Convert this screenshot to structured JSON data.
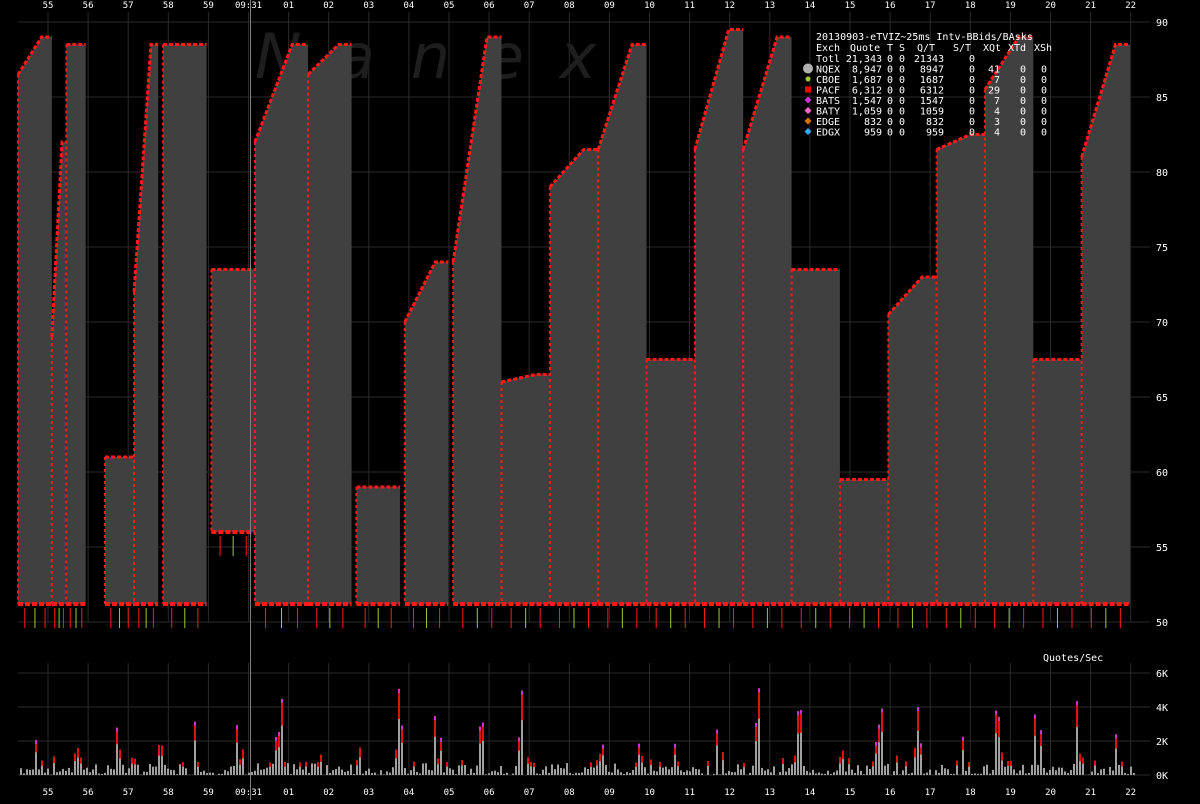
{
  "colors": {
    "background": "#000000",
    "bar_fill": "#404040",
    "grid": "#2a2a2a",
    "bid_ask": "#ff1a1a",
    "text": "#ffffff",
    "watermark": "#1e1e1e",
    "crosshair": "#808080"
  },
  "watermark_text": "N a n e x",
  "legend": {
    "title": "20130903-eTVIZ~25ms Intv-BBids/BAsks",
    "header": [
      "Exch",
      "Quote",
      "T",
      "S",
      "Q/T",
      "S/T",
      "XQt",
      "XTd",
      "XSh"
    ],
    "rows": [
      {
        "exch": "Totl",
        "quote": "21,343",
        "t": "0",
        "s": "0",
        "qt": "21343",
        "st": "0",
        "xqt": "",
        "xtd": "",
        "xsh": "",
        "color": "",
        "marker": ""
      },
      {
        "exch": "NQEX",
        "quote": "8,947",
        "t": "0",
        "s": "0",
        "qt": "8947",
        "st": "0",
        "xqt": "41",
        "xtd": "0",
        "xsh": "0",
        "color": "#b0b0b0",
        "marker": "circle"
      },
      {
        "exch": "CBOE",
        "quote": "1,687",
        "t": "0",
        "s": "0",
        "qt": "1687",
        "st": "0",
        "xqt": "7",
        "xtd": "0",
        "xsh": "0",
        "color": "#9acd32",
        "marker": "dot"
      },
      {
        "exch": "PACF",
        "quote": "6,312",
        "t": "0",
        "s": "0",
        "qt": "6312",
        "st": "0",
        "xqt": "29",
        "xtd": "0",
        "xsh": "0",
        "color": "#ff0000",
        "marker": "square"
      },
      {
        "exch": "BATS",
        "quote": "1,547",
        "t": "0",
        "s": "0",
        "qt": "1547",
        "st": "0",
        "xqt": "7",
        "xtd": "0",
        "xsh": "0",
        "color": "#cc33cc",
        "marker": "diamond"
      },
      {
        "exch": "BATY",
        "quote": "1,059",
        "t": "0",
        "s": "0",
        "qt": "1059",
        "st": "0",
        "xqt": "4",
        "xtd": "0",
        "xsh": "0",
        "color": "#ff66cc",
        "marker": "diamond"
      },
      {
        "exch": "EDGE",
        "quote": "832",
        "t": "0",
        "s": "0",
        "qt": "832",
        "st": "0",
        "xqt": "3",
        "xtd": "0",
        "xsh": "0",
        "color": "#e07000",
        "marker": "diamond"
      },
      {
        "exch": "EDGX",
        "quote": "959",
        "t": "0",
        "s": "0",
        "qt": "959",
        "st": "0",
        "xqt": "4",
        "xtd": "0",
        "xsh": "0",
        "color": "#33aaff",
        "marker": "diamond"
      }
    ]
  },
  "volume_panel_label": "Quotes/Sec",
  "chart_data": [
    {
      "type": "bar",
      "name": "",
      "x_tick_labels": [
        "55",
        "56",
        "57",
        "58",
        "59",
        "09:31",
        "01",
        "02",
        "03",
        "04",
        "05",
        "06",
        "07",
        "08",
        "09",
        "10",
        "11",
        "12",
        "13",
        "14",
        "15",
        "16",
        "17",
        "18",
        "19",
        "20",
        "21",
        "22"
      ],
      "y_tick_labels": [
        "50",
        "55",
        "60",
        "65",
        "70",
        "75",
        "80",
        "85",
        "90"
      ],
      "ylim": [
        50,
        90
      ],
      "grid": true,
      "y_axis_side": "right",
      "x_axis_side": "top-and-bottom",
      "cursor_label": "09:31",
      "description_of_pattern": "",
      "best_bid_floor": 51.2,
      "segments": [
        {
          "x": [
            0.0,
            0.7
          ],
          "top": [
            86.5,
            89.0
          ],
          "bottom": 51.2
        },
        {
          "x": [
            0.7,
            1.0
          ],
          "top": [
            69,
            82
          ],
          "bottom": 51.2
        },
        {
          "x": [
            1.0,
            1.4
          ],
          "top": [
            88.5,
            88.5
          ],
          "bottom": 51.2
        },
        {
          "x": [
            1.8,
            2.4
          ],
          "top": [
            61,
            61
          ],
          "bottom": 51.2
        },
        {
          "x": [
            2.4,
            2.9
          ],
          "top": [
            72,
            88.5
          ],
          "bottom": 51.2
        },
        {
          "x": [
            3.0,
            3.9
          ],
          "top": [
            88.5,
            88.5
          ],
          "bottom": 51.2
        },
        {
          "x": [
            4.0,
            4.9
          ],
          "top": [
            73.5,
            73.5
          ],
          "bottom": 56.0
        },
        {
          "x": [
            4.9,
            6.0
          ],
          "top": [
            82,
            88.5
          ],
          "bottom": 51.2
        },
        {
          "x": [
            6.0,
            6.9
          ],
          "top": [
            86.5,
            88.5
          ],
          "bottom": 51.2
        },
        {
          "x": [
            7.0,
            7.9
          ],
          "top": [
            59,
            59
          ],
          "bottom": 51.2
        },
        {
          "x": [
            8.0,
            8.9
          ],
          "top": [
            70,
            74
          ],
          "bottom": 51.2
        },
        {
          "x": [
            9.0,
            10.0
          ],
          "top": [
            74,
            89
          ],
          "bottom": 51.2
        },
        {
          "x": [
            10.0,
            11.0
          ],
          "top": [
            66,
            66.5
          ],
          "bottom": 51.2
        },
        {
          "x": [
            11.0,
            12.0
          ],
          "top": [
            79,
            81.5
          ],
          "bottom": 51.2
        },
        {
          "x": [
            12.0,
            13.0
          ],
          "top": [
            81.5,
            88.5
          ],
          "bottom": 51.2
        },
        {
          "x": [
            13.0,
            14.0
          ],
          "top": [
            67.5,
            67.5
          ],
          "bottom": 51.2
        },
        {
          "x": [
            14.0,
            15.0
          ],
          "top": [
            81.5,
            89.5
          ],
          "bottom": 51.2
        },
        {
          "x": [
            15.0,
            16.0
          ],
          "top": [
            81.5,
            89
          ],
          "bottom": 51.2
        },
        {
          "x": [
            16.0,
            17.0
          ],
          "top": [
            73.5,
            73.5
          ],
          "bottom": 51.2
        },
        {
          "x": [
            17.0,
            18.0
          ],
          "top": [
            59.5,
            59.5
          ],
          "bottom": 51.2
        },
        {
          "x": [
            18.0,
            19.0
          ],
          "top": [
            70.5,
            73
          ],
          "bottom": 51.2
        },
        {
          "x": [
            19.0,
            20.0
          ],
          "top": [
            81.5,
            82.5
          ],
          "bottom": 51.2
        },
        {
          "x": [
            20.0,
            21.0
          ],
          "top": [
            85.5,
            89
          ],
          "bottom": 51.2
        },
        {
          "x": [
            21.0,
            22.0
          ],
          "top": [
            67.5,
            67.5
          ],
          "bottom": 51.2
        },
        {
          "x": [
            22.0,
            23.0
          ],
          "top": [
            81,
            88.5
          ],
          "bottom": 51.2
        }
      ]
    },
    {
      "type": "bar",
      "name": "Quotes/Sec",
      "y_tick_labels": [
        "0K",
        "2K",
        "4K",
        "6K"
      ],
      "ylim": [
        0,
        6000
      ],
      "grid": true,
      "y_axis_side": "right"
    }
  ]
}
